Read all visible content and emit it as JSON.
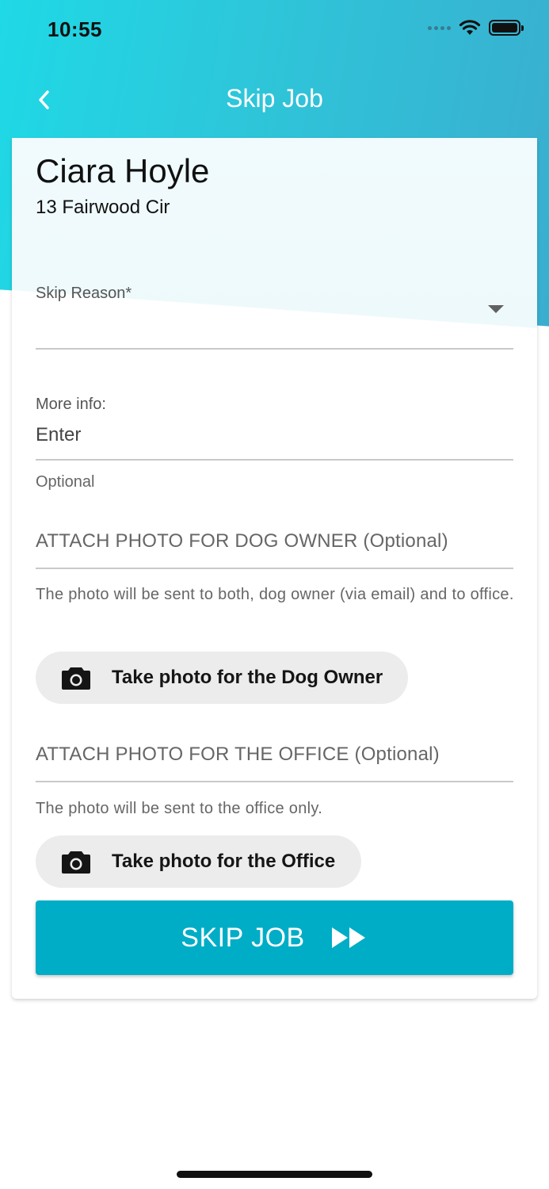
{
  "status_bar": {
    "time": "10:55",
    "signal_icon": "cellular-signal-icon",
    "wifi_icon": "wifi-icon",
    "battery_icon": "battery-icon"
  },
  "nav": {
    "back_icon": "chevron-left-icon",
    "title": "Skip Job"
  },
  "client": {
    "name": "Ciara Hoyle",
    "address": "13 Fairwood Cir"
  },
  "form": {
    "skip_reason": {
      "label": "Skip Reason*",
      "value": "",
      "arrow_icon": "dropdown-arrow-icon"
    },
    "more_info": {
      "label": "More info:",
      "placeholder": "Enter",
      "helper": "Optional"
    },
    "owner_photo": {
      "title": "ATTACH PHOTO FOR DOG OWNER (Optional)",
      "description": "The photo will be sent to both, dog owner (via email) and to office.",
      "button_label": "Take photo for the Dog Owner",
      "icon": "camera-icon"
    },
    "office_photo": {
      "title": "ATTACH PHOTO FOR THE OFFICE (Optional)",
      "description": "The photo will be sent to the office only.",
      "button_label": "Take photo for the Office",
      "icon": "camera-icon"
    }
  },
  "skip_button": {
    "label": "SKIP JOB",
    "icon": "fast-forward-icon"
  },
  "colors": {
    "header_gradient_start": "#1fd9e6",
    "header_gradient_end": "#3aaecf",
    "primary_button": "#00adc6",
    "photo_button_bg": "#ececec"
  }
}
